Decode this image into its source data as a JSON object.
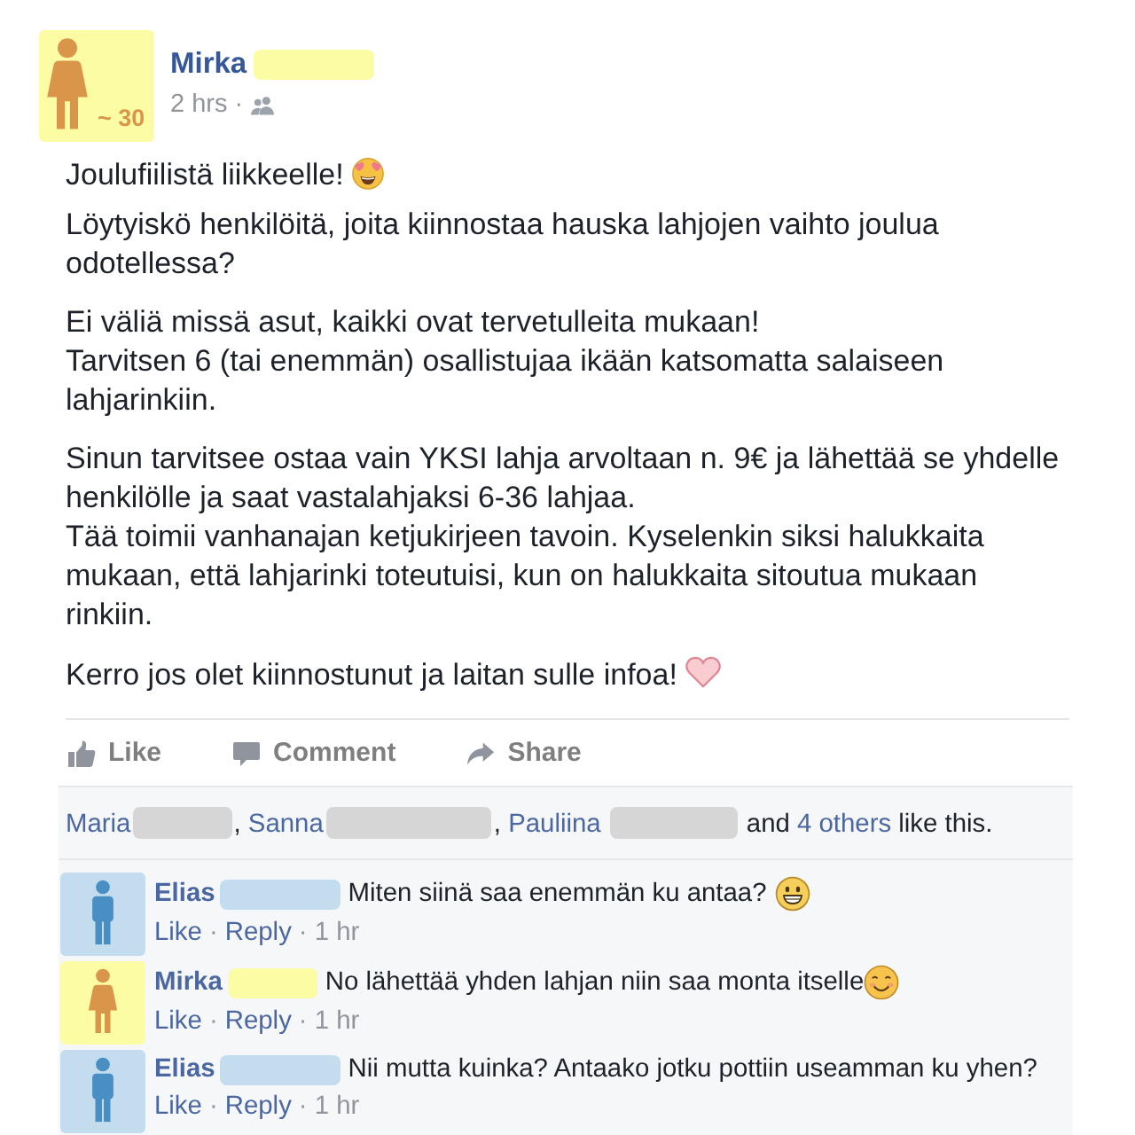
{
  "post": {
    "author": {
      "name": "Mirka",
      "redacted": true,
      "avatar": {
        "kind": "woman",
        "label": "~ 30"
      }
    },
    "time": "2 hrs",
    "separator": "·",
    "paragraphs": [
      {
        "text": "Joulufiilistä liikkeelle!",
        "emoji": {
          "kind": "heart_eyes"
        }
      },
      {
        "text": "Löytyiskö henkilöitä, joita kiinnostaa hauska lahjojen vaihto joulua odotellessa?"
      },
      {
        "text": "Ei väliä missä asut, kaikki ovat tervetulleita mukaan!\nTarvitsen 6 (tai enemmän) osallistujaa ikään katsomatta salaiseen lahjarinkiin."
      },
      {
        "text": "Sinun tarvitsee ostaa vain YKSI lahja arvoltaan n. 9€ ja lähettää se yhdelle henkilölle ja saat vastalahjaksi 6-36 lahjaa.\nTää toimii vanhanajan ketjukirjeen tavoin. Kyselenkin siksi halukkaita mukaan, että lahjarinki toteutuisi, kun on halukkaita sitoutua mukaan rinkiin."
      },
      {
        "text": "Kerro jos olet kiinnostunut ja laitan sulle infoa!",
        "emoji": {
          "kind": "heart"
        }
      }
    ]
  },
  "actions": [
    {
      "kind": "like",
      "label": "Like"
    },
    {
      "kind": "comment",
      "label": "Comment"
    },
    {
      "kind": "share",
      "label": "Share"
    }
  ],
  "likes": [
    {
      "kind": "name",
      "text": "Maria"
    },
    {
      "kind": "redacted"
    },
    {
      "kind": "plain",
      "text": ", "
    },
    {
      "kind": "name",
      "text": "Sanna"
    },
    {
      "kind": "redacted"
    },
    {
      "kind": "plain",
      "text": ", "
    },
    {
      "kind": "name",
      "text": "Pauliina"
    },
    {
      "kind": "redacted"
    },
    {
      "kind": "plain",
      "text": " and "
    },
    {
      "kind": "link",
      "text": "4 others"
    },
    {
      "kind": "plain",
      "text": " like this."
    }
  ],
  "comments": [
    {
      "avatar": {
        "kind": "man"
      },
      "name": "Elias",
      "redacted": true,
      "text": "Miten siinä saa enemmän ku antaa?",
      "emoji": {
        "kind": "grin"
      },
      "footer": [
        {
          "kind": "link",
          "text": "Like"
        },
        {
          "kind": "sep",
          "text": "·"
        },
        {
          "kind": "link",
          "text": "Reply"
        },
        {
          "kind": "sep",
          "text": "·"
        },
        {
          "kind": "time",
          "text": "1 hr"
        }
      ]
    },
    {
      "avatar": {
        "kind": "woman"
      },
      "name": "Mirka",
      "redacted": true,
      "text": "No lähettää yhden lahjan niin saa monta itselle",
      "emoji": {
        "kind": "smile"
      },
      "footer": [
        {
          "kind": "link",
          "text": "Like"
        },
        {
          "kind": "sep",
          "text": "·"
        },
        {
          "kind": "link",
          "text": "Reply"
        },
        {
          "kind": "sep",
          "text": "·"
        },
        {
          "kind": "time",
          "text": "1 hr"
        }
      ]
    },
    {
      "avatar": {
        "kind": "man"
      },
      "name": "Elias",
      "redacted": true,
      "text": "Nii mutta kuinka? Antaako jotku pottiin useamman ku yhen?",
      "footer": [
        {
          "kind": "link",
          "text": "Like"
        },
        {
          "kind": "sep",
          "text": "·"
        },
        {
          "kind": "link",
          "text": "Reply"
        },
        {
          "kind": "sep",
          "text": "·"
        },
        {
          "kind": "time",
          "text": "1 hr"
        }
      ]
    }
  ]
}
